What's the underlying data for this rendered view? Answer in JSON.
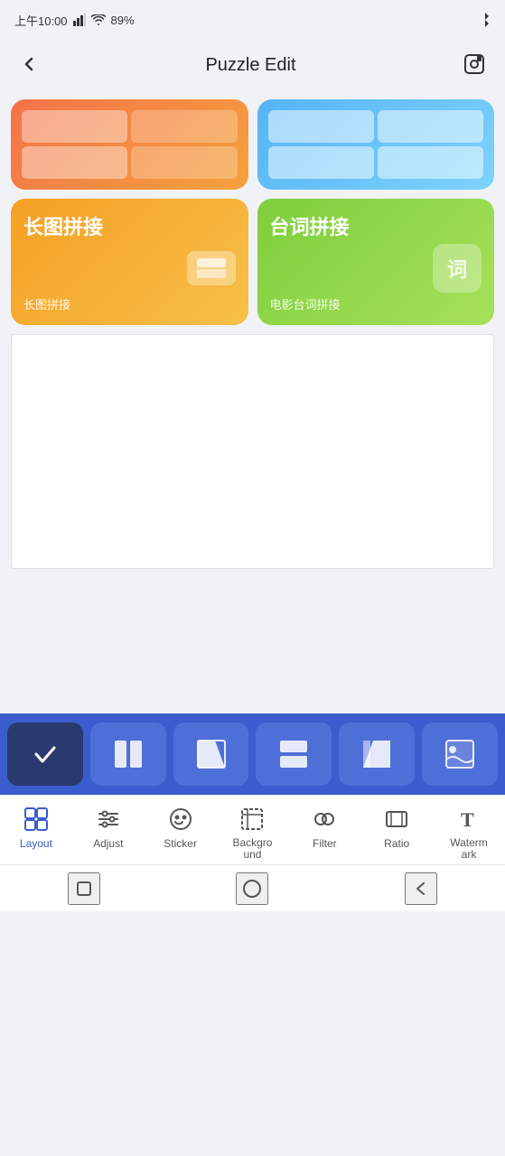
{
  "statusBar": {
    "time": "上午10:00",
    "batteryLevel": "89"
  },
  "header": {
    "backLabel": "‹",
    "title": "Puzzle Edit",
    "saveIcon": "save-icon"
  },
  "puzzleCards": {
    "topRow": [
      {
        "id": "card-orange-top",
        "type": "grid-orange"
      },
      {
        "id": "card-blue-top",
        "type": "grid-blue"
      }
    ],
    "bottomRow": [
      {
        "id": "card-long",
        "title": "长图拼接",
        "subtitle": "长图拼接",
        "type": "orange"
      },
      {
        "id": "card-script",
        "title": "台词拼接",
        "subtitle": "电影台词拼接",
        "iconText": "词",
        "type": "green"
      }
    ]
  },
  "layoutStrip": {
    "buttons": [
      {
        "id": "layout-check",
        "active": true,
        "icon": "check"
      },
      {
        "id": "layout-two-col",
        "active": false,
        "icon": "two-col"
      },
      {
        "id": "layout-diagonal",
        "active": false,
        "icon": "diagonal"
      },
      {
        "id": "layout-horizontal",
        "active": false,
        "icon": "horizontal"
      },
      {
        "id": "layout-perspective",
        "active": false,
        "icon": "perspective"
      },
      {
        "id": "layout-wave",
        "active": false,
        "icon": "wave"
      }
    ]
  },
  "toolbar": {
    "items": [
      {
        "id": "layout",
        "label": "Layout",
        "active": true
      },
      {
        "id": "adjust",
        "label": "Adjust",
        "active": false
      },
      {
        "id": "sticker",
        "label": "Sticker",
        "active": false
      },
      {
        "id": "background",
        "label": "Background",
        "active": false
      },
      {
        "id": "filter",
        "label": "Filter",
        "active": false
      },
      {
        "id": "ratio",
        "label": "Ratio",
        "active": false
      },
      {
        "id": "watermark",
        "label": "Watermark",
        "active": false
      }
    ]
  }
}
